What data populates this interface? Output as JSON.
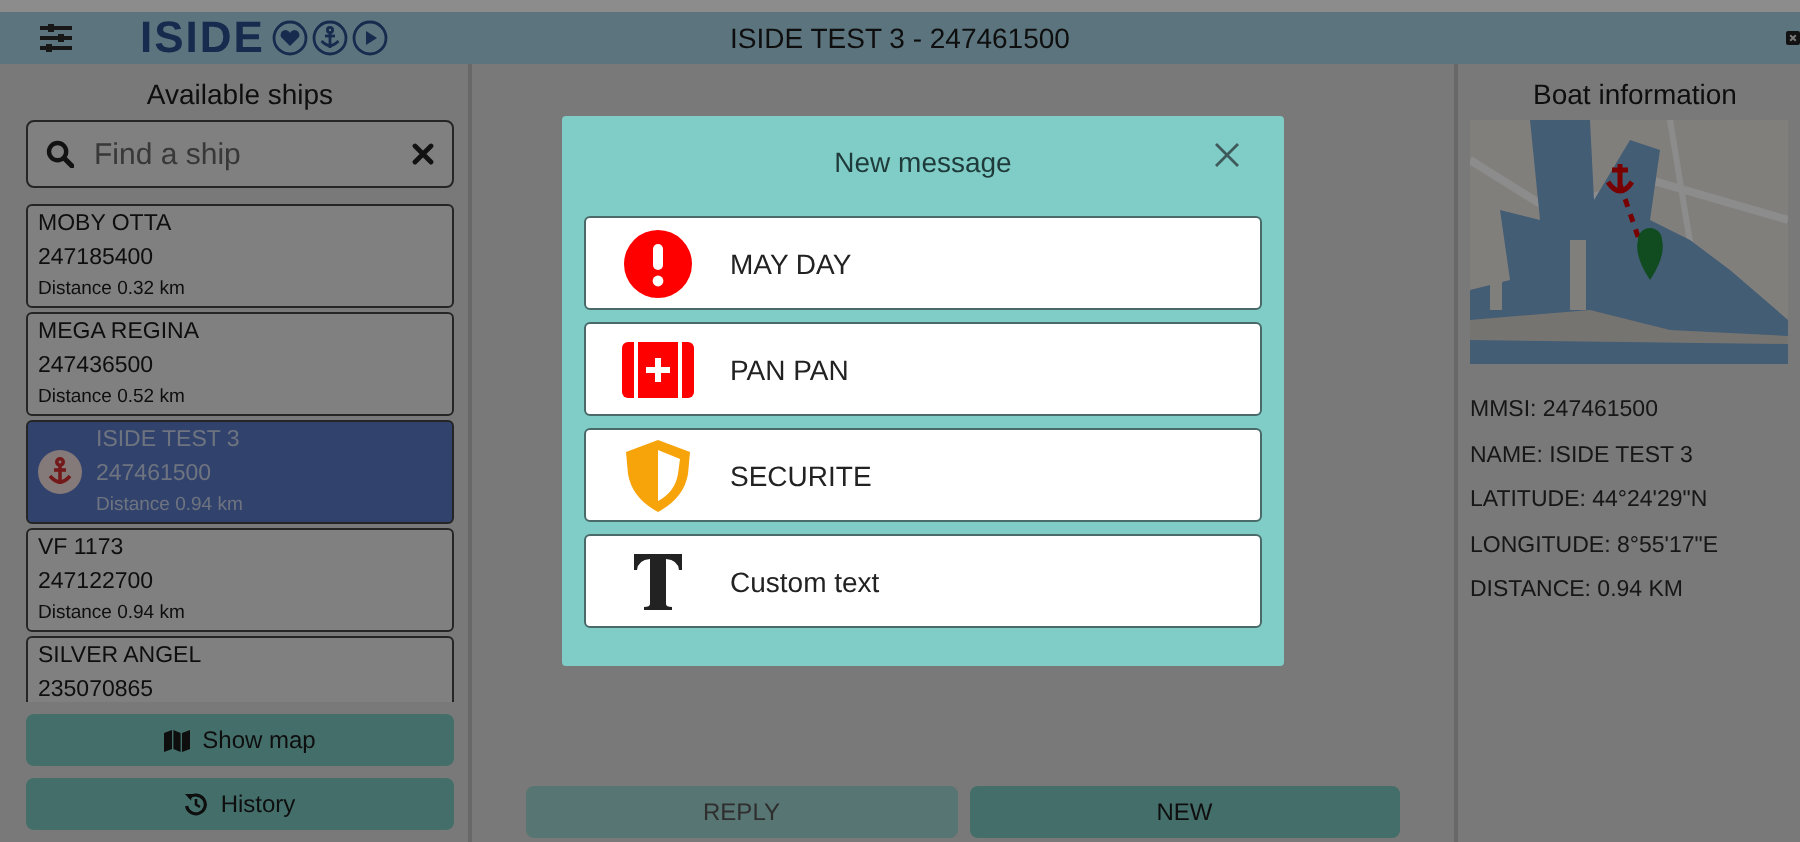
{
  "header": {
    "logo": "ISIDE",
    "title": "ISIDE TEST 3 - 247461500"
  },
  "ships_panel": {
    "heading": "Available ships",
    "search": {
      "placeholder": "Find a ship"
    },
    "ships": [
      {
        "name": "MOBY OTTA",
        "mmsi": "247185400",
        "distance": "Distance 0.32 km",
        "selected": false
      },
      {
        "name": "MEGA REGINA",
        "mmsi": "247436500",
        "distance": "Distance 0.52 km",
        "selected": false
      },
      {
        "name": "ISIDE TEST 3",
        "mmsi": "247461500",
        "distance": "Distance 0.94 km",
        "selected": true
      },
      {
        "name": "VF 1173",
        "mmsi": "247122700",
        "distance": "Distance 0.94 km",
        "selected": false
      },
      {
        "name": "SILVER ANGEL",
        "mmsi": "235070865",
        "selected": false
      }
    ],
    "buttons": [
      {
        "label": "Show map",
        "kind": "map"
      },
      {
        "label": "History",
        "kind": "history"
      }
    ]
  },
  "messages_panel": {
    "buttons": [
      {
        "label": "REPLY",
        "disabled": true
      },
      {
        "label": "NEW",
        "disabled": false
      }
    ]
  },
  "boat_info": {
    "heading": "Boat information",
    "fields": [
      "MMSI: 247461500",
      "NAME: ISIDE TEST 3",
      "LATITUDE: 44°24'29\"N",
      "LONGITUDE: 8°55'17\"E",
      "DISTANCE: 0.94 KM"
    ]
  },
  "modal": {
    "title": "New message",
    "options": [
      {
        "label": "MAY DAY",
        "kind": "mayday"
      },
      {
        "label": "PAN PAN",
        "kind": "panpan"
      },
      {
        "label": "SECURITE",
        "kind": "securite"
      },
      {
        "label": "Custom text",
        "kind": "text"
      }
    ]
  }
}
